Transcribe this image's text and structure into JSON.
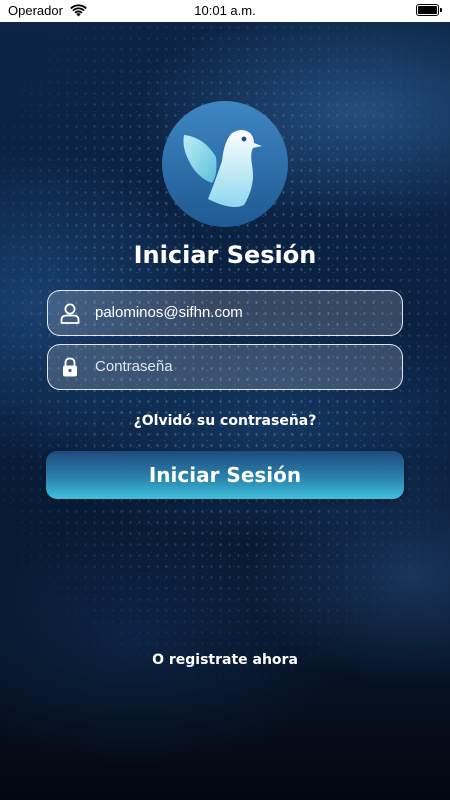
{
  "status_bar": {
    "carrier": "Operador",
    "time": "10:01 a.m.",
    "wifi_icon": "wifi-icon",
    "battery_icon": "battery-icon"
  },
  "logo": {
    "icon": "dove-icon"
  },
  "login": {
    "title": "Iniciar Sesión",
    "email": {
      "icon": "user-icon",
      "value": "palominos@sifhn.com"
    },
    "password": {
      "icon": "lock-icon",
      "placeholder": "Contraseña"
    },
    "forgot_password": "¿Olvidó su contraseña?",
    "submit_label": "Iniciar Sesión",
    "register_link": "O registrate ahora"
  },
  "colors": {
    "background": "#0a2040",
    "button_top": "#1f4a80",
    "button_bottom": "#3ec0dc",
    "logo_circle": "#2e6fa8"
  }
}
